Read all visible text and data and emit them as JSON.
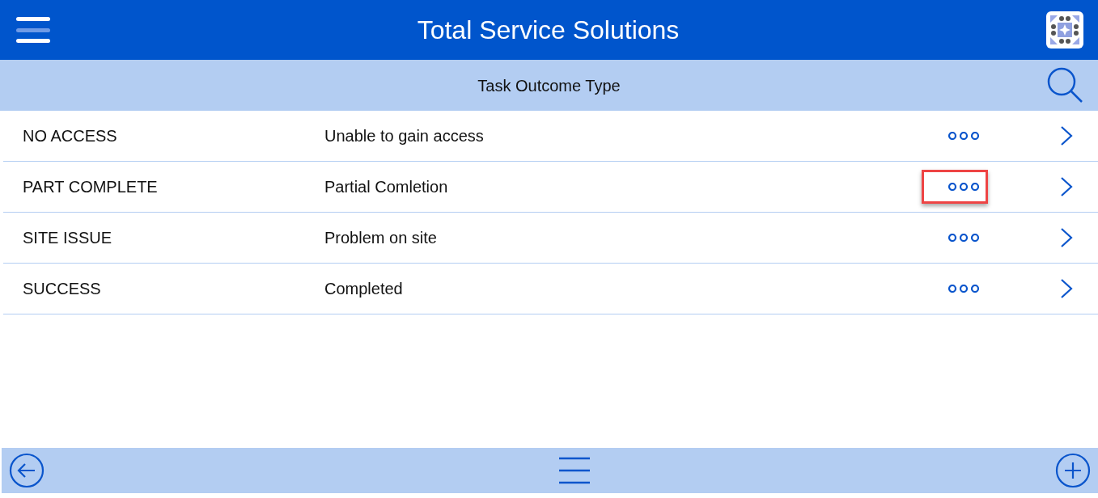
{
  "header": {
    "title": "Total Service Solutions"
  },
  "subheader": {
    "title": "Task Outcome Type"
  },
  "rows": [
    {
      "code": "NO ACCESS",
      "description": "Unable to gain access",
      "highlighted": false
    },
    {
      "code": "PART COMPLETE",
      "description": "Partial Comletion",
      "highlighted": true
    },
    {
      "code": "SITE ISSUE",
      "description": "Problem on site",
      "highlighted": false
    },
    {
      "code": "SUCCESS",
      "description": "Completed",
      "highlighted": false
    }
  ]
}
